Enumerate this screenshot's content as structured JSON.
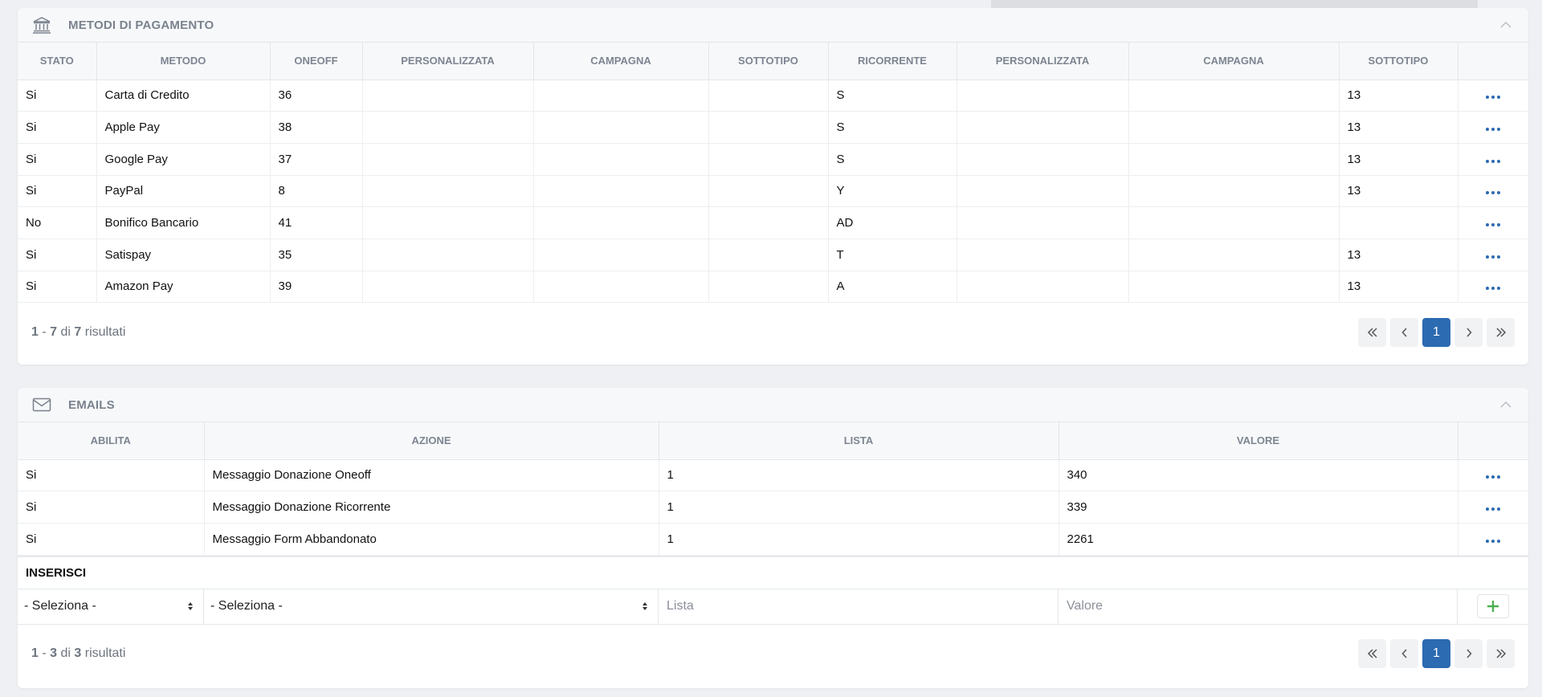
{
  "payments": {
    "title": "METODI DI PAGAMENTO",
    "columns": [
      "STATO",
      "METODO",
      "ONEOFF",
      "PERSONALIZZATA",
      "CAMPAGNA",
      "SOTTOTIPO",
      "RICORRENTE",
      "PERSONALIZZATA",
      "CAMPAGNA",
      "SOTTOTIPO",
      ""
    ],
    "rows": [
      {
        "stato": "Si",
        "metodo": "Carta di Credito",
        "oneoff": "36",
        "pers1": "",
        "camp1": "",
        "sott1": "",
        "ricorrente": "S",
        "pers2": "",
        "camp2": "",
        "sott2": "13"
      },
      {
        "stato": "Si",
        "metodo": "Apple Pay",
        "oneoff": "38",
        "pers1": "",
        "camp1": "",
        "sott1": "",
        "ricorrente": "S",
        "pers2": "",
        "camp2": "",
        "sott2": "13"
      },
      {
        "stato": "Si",
        "metodo": "Google Pay",
        "oneoff": "37",
        "pers1": "",
        "camp1": "",
        "sott1": "",
        "ricorrente": "S",
        "pers2": "",
        "camp2": "",
        "sott2": "13"
      },
      {
        "stato": "Si",
        "metodo": "PayPal",
        "oneoff": "8",
        "pers1": "",
        "camp1": "",
        "sott1": "",
        "ricorrente": "Y",
        "pers2": "",
        "camp2": "",
        "sott2": "13"
      },
      {
        "stato": "No",
        "metodo": "Bonifico Bancario",
        "oneoff": "41",
        "pers1": "",
        "camp1": "",
        "sott1": "",
        "ricorrente": "AD",
        "pers2": "",
        "camp2": "",
        "sott2": ""
      },
      {
        "stato": "Si",
        "metodo": "Satispay",
        "oneoff": "35",
        "pers1": "",
        "camp1": "",
        "sott1": "",
        "ricorrente": "T",
        "pers2": "",
        "camp2": "",
        "sott2": "13"
      },
      {
        "stato": "Si",
        "metodo": "Amazon Pay",
        "oneoff": "39",
        "pers1": "",
        "camp1": "",
        "sott1": "",
        "ricorrente": "A",
        "pers2": "",
        "camp2": "",
        "sott2": "13"
      }
    ],
    "footer": {
      "from": "1",
      "to": "7",
      "of_label": "di",
      "total": "7",
      "results_label": "risultati"
    },
    "pagination": {
      "current": "1"
    }
  },
  "emails": {
    "title": "EMAILS",
    "columns": [
      "ABILITA",
      "AZIONE",
      "LISTA",
      "VALORE",
      ""
    ],
    "rows": [
      {
        "abilita": "Si",
        "azione": "Messaggio Donazione Oneoff",
        "lista": "1",
        "valore": "340"
      },
      {
        "abilita": "Si",
        "azione": "Messaggio Donazione Ricorrente",
        "lista": "1",
        "valore": "339"
      },
      {
        "abilita": "Si",
        "azione": "Messaggio Form Abbandonato",
        "lista": "1",
        "valore": "2261"
      }
    ],
    "insert": {
      "title": "INSERISCI",
      "abilita_select": "- Seleziona -",
      "azione_select": "- Seleziona -",
      "lista_placeholder": "Lista",
      "valore_placeholder": "Valore"
    },
    "footer": {
      "from": "1",
      "to": "3",
      "of_label": "di",
      "total": "3",
      "results_label": "risultati"
    },
    "pagination": {
      "current": "1"
    }
  },
  "colors": {
    "accent": "#2c6ab1",
    "add": "#4caf50",
    "muted": "#7a828d"
  },
  "icons": {
    "payments": "bank-icon",
    "emails": "envelope-icon",
    "more": "ellipsis-icon",
    "add": "plus-icon"
  }
}
